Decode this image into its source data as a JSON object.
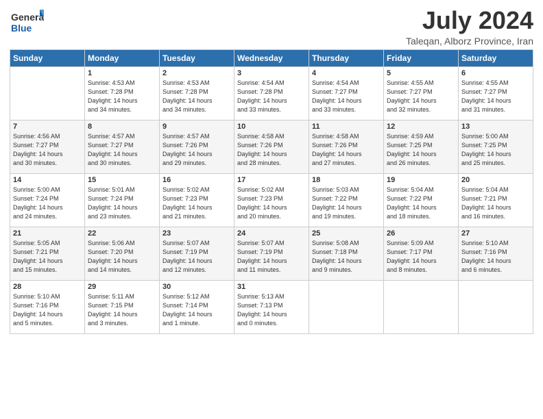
{
  "logo": {
    "line1": "General",
    "line2": "Blue"
  },
  "title": "July 2024",
  "location": "Taleqan, Alborz Province, Iran",
  "weekdays": [
    "Sunday",
    "Monday",
    "Tuesday",
    "Wednesday",
    "Thursday",
    "Friday",
    "Saturday"
  ],
  "weeks": [
    [
      {
        "day": "",
        "info": ""
      },
      {
        "day": "1",
        "info": "Sunrise: 4:53 AM\nSunset: 7:28 PM\nDaylight: 14 hours\nand 34 minutes."
      },
      {
        "day": "2",
        "info": "Sunrise: 4:53 AM\nSunset: 7:28 PM\nDaylight: 14 hours\nand 34 minutes."
      },
      {
        "day": "3",
        "info": "Sunrise: 4:54 AM\nSunset: 7:28 PM\nDaylight: 14 hours\nand 33 minutes."
      },
      {
        "day": "4",
        "info": "Sunrise: 4:54 AM\nSunset: 7:27 PM\nDaylight: 14 hours\nand 33 minutes."
      },
      {
        "day": "5",
        "info": "Sunrise: 4:55 AM\nSunset: 7:27 PM\nDaylight: 14 hours\nand 32 minutes."
      },
      {
        "day": "6",
        "info": "Sunrise: 4:55 AM\nSunset: 7:27 PM\nDaylight: 14 hours\nand 31 minutes."
      }
    ],
    [
      {
        "day": "7",
        "info": "Sunrise: 4:56 AM\nSunset: 7:27 PM\nDaylight: 14 hours\nand 30 minutes."
      },
      {
        "day": "8",
        "info": "Sunrise: 4:57 AM\nSunset: 7:27 PM\nDaylight: 14 hours\nand 30 minutes."
      },
      {
        "day": "9",
        "info": "Sunrise: 4:57 AM\nSunset: 7:26 PM\nDaylight: 14 hours\nand 29 minutes."
      },
      {
        "day": "10",
        "info": "Sunrise: 4:58 AM\nSunset: 7:26 PM\nDaylight: 14 hours\nand 28 minutes."
      },
      {
        "day": "11",
        "info": "Sunrise: 4:58 AM\nSunset: 7:26 PM\nDaylight: 14 hours\nand 27 minutes."
      },
      {
        "day": "12",
        "info": "Sunrise: 4:59 AM\nSunset: 7:25 PM\nDaylight: 14 hours\nand 26 minutes."
      },
      {
        "day": "13",
        "info": "Sunrise: 5:00 AM\nSunset: 7:25 PM\nDaylight: 14 hours\nand 25 minutes."
      }
    ],
    [
      {
        "day": "14",
        "info": "Sunrise: 5:00 AM\nSunset: 7:24 PM\nDaylight: 14 hours\nand 24 minutes."
      },
      {
        "day": "15",
        "info": "Sunrise: 5:01 AM\nSunset: 7:24 PM\nDaylight: 14 hours\nand 23 minutes."
      },
      {
        "day": "16",
        "info": "Sunrise: 5:02 AM\nSunset: 7:23 PM\nDaylight: 14 hours\nand 21 minutes."
      },
      {
        "day": "17",
        "info": "Sunrise: 5:02 AM\nSunset: 7:23 PM\nDaylight: 14 hours\nand 20 minutes."
      },
      {
        "day": "18",
        "info": "Sunrise: 5:03 AM\nSunset: 7:22 PM\nDaylight: 14 hours\nand 19 minutes."
      },
      {
        "day": "19",
        "info": "Sunrise: 5:04 AM\nSunset: 7:22 PM\nDaylight: 14 hours\nand 18 minutes."
      },
      {
        "day": "20",
        "info": "Sunrise: 5:04 AM\nSunset: 7:21 PM\nDaylight: 14 hours\nand 16 minutes."
      }
    ],
    [
      {
        "day": "21",
        "info": "Sunrise: 5:05 AM\nSunset: 7:21 PM\nDaylight: 14 hours\nand 15 minutes."
      },
      {
        "day": "22",
        "info": "Sunrise: 5:06 AM\nSunset: 7:20 PM\nDaylight: 14 hours\nand 14 minutes."
      },
      {
        "day": "23",
        "info": "Sunrise: 5:07 AM\nSunset: 7:19 PM\nDaylight: 14 hours\nand 12 minutes."
      },
      {
        "day": "24",
        "info": "Sunrise: 5:07 AM\nSunset: 7:19 PM\nDaylight: 14 hours\nand 11 minutes."
      },
      {
        "day": "25",
        "info": "Sunrise: 5:08 AM\nSunset: 7:18 PM\nDaylight: 14 hours\nand 9 minutes."
      },
      {
        "day": "26",
        "info": "Sunrise: 5:09 AM\nSunset: 7:17 PM\nDaylight: 14 hours\nand 8 minutes."
      },
      {
        "day": "27",
        "info": "Sunrise: 5:10 AM\nSunset: 7:16 PM\nDaylight: 14 hours\nand 6 minutes."
      }
    ],
    [
      {
        "day": "28",
        "info": "Sunrise: 5:10 AM\nSunset: 7:16 PM\nDaylight: 14 hours\nand 5 minutes."
      },
      {
        "day": "29",
        "info": "Sunrise: 5:11 AM\nSunset: 7:15 PM\nDaylight: 14 hours\nand 3 minutes."
      },
      {
        "day": "30",
        "info": "Sunrise: 5:12 AM\nSunset: 7:14 PM\nDaylight: 14 hours\nand 1 minute."
      },
      {
        "day": "31",
        "info": "Sunrise: 5:13 AM\nSunset: 7:13 PM\nDaylight: 14 hours\nand 0 minutes."
      },
      {
        "day": "",
        "info": ""
      },
      {
        "day": "",
        "info": ""
      },
      {
        "day": "",
        "info": ""
      }
    ]
  ]
}
